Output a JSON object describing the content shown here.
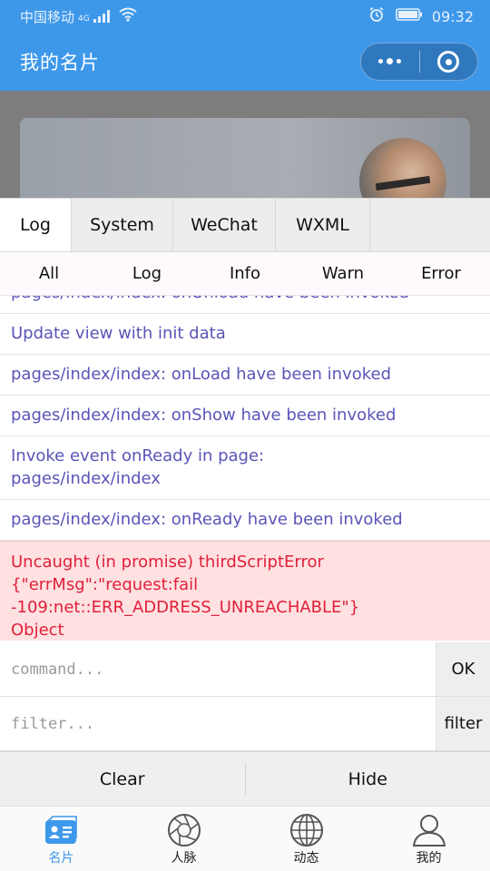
{
  "status_bar": {
    "carrier": "中国移动",
    "network": "4G",
    "time": "09:32"
  },
  "nav": {
    "title": "我的名片"
  },
  "console": {
    "tabs": [
      {
        "label": "Log",
        "active": true
      },
      {
        "label": "System",
        "active": false
      },
      {
        "label": "WeChat",
        "active": false
      },
      {
        "label": "WXML",
        "active": false
      }
    ],
    "filters": [
      {
        "label": "All"
      },
      {
        "label": "Log"
      },
      {
        "label": "Info"
      },
      {
        "label": "Warn"
      },
      {
        "label": "Error"
      }
    ],
    "logs": [
      {
        "text": "pages/index/index: onUnload have been invoked",
        "level": "log",
        "partially_hidden": true
      },
      {
        "text": "Update view with init data",
        "level": "log"
      },
      {
        "text": "pages/index/index: onLoad have been invoked",
        "level": "log"
      },
      {
        "text": "pages/index/index: onShow have been invoked",
        "level": "log"
      },
      {
        "text_lines": [
          "Invoke event onReady in page:",
          "pages/index/index"
        ],
        "level": "log"
      },
      {
        "text": "pages/index/index: onReady have been invoked",
        "level": "log"
      },
      {
        "text_lines": [
          "Uncaught (in promise) thirdScriptError",
          "{\"errMsg\":\"request:fail",
          "-109:net::ERR_ADDRESS_UNREACHABLE\"}",
          "Object"
        ],
        "level": "error"
      }
    ],
    "command": {
      "placeholder": "command...",
      "value": "",
      "button": "OK"
    },
    "filter": {
      "placeholder": "filter...",
      "value": "",
      "button": "filter"
    },
    "actions": {
      "clear": "Clear",
      "hide": "Hide"
    }
  },
  "tabbar": {
    "items": [
      {
        "label": "名片",
        "icon": "card-icon",
        "active": true
      },
      {
        "label": "人脉",
        "icon": "aperture-icon",
        "active": false
      },
      {
        "label": "动态",
        "icon": "globe-icon",
        "active": false
      },
      {
        "label": "我的",
        "icon": "person-icon",
        "active": false
      }
    ]
  },
  "colors": {
    "brand": "#3e98ea",
    "log_text": "#5a55b8",
    "error_text": "#e0203a",
    "error_bg": "#ffe1e1"
  }
}
